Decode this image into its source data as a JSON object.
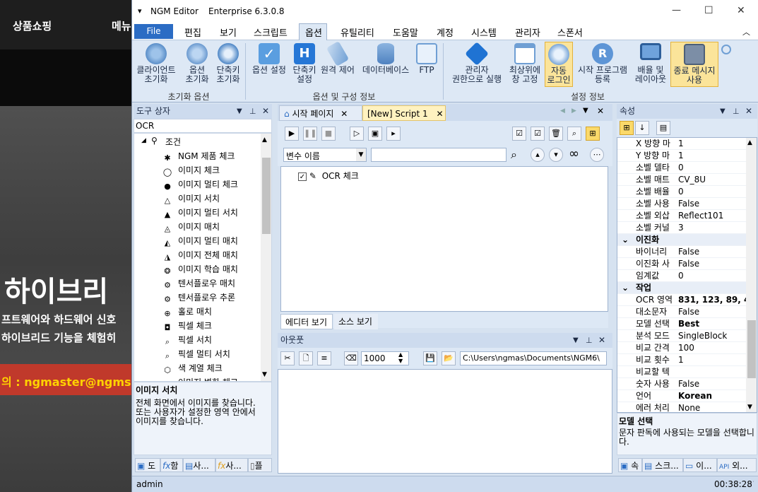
{
  "background_site": {
    "nav": [
      "상품쇼핑",
      "메뉴"
    ],
    "headline": "하이브리",
    "line1": "프트웨어와 하드웨어 신호",
    "line2": "하이브리드 기능을 체험히",
    "contact": "의 : ngmaster@ngms"
  },
  "window": {
    "app_name": "NGM Editor",
    "edition": "Enterprise 6.3.0.8",
    "controls": {
      "minimize": "—",
      "maximize": "☐",
      "close": "✕"
    }
  },
  "menu": {
    "file": "File",
    "items": [
      "편집",
      "보기",
      "스크립트",
      "옵션",
      "유틸리티",
      "도움말",
      "계정",
      "시스템",
      "관리자",
      "스폰서"
    ],
    "active": "옵션",
    "collapse": "︿"
  },
  "ribbon": {
    "groups": [
      {
        "label": "초기화 옵션",
        "buttons": [
          {
            "label": "클라이언트\n초기화",
            "icon": "gear-cluster-icon"
          },
          {
            "label": "옵션\n초기화",
            "icon": "gear-icon"
          },
          {
            "label": "단축키\n초기화",
            "icon": "gear-reset-icon"
          }
        ]
      },
      {
        "label": "옵션 및 구성 정보",
        "buttons": [
          {
            "label": "옵션 설정",
            "icon": "check-icon"
          },
          {
            "label": "단축키\n설정",
            "icon": "hotkey-icon"
          },
          {
            "label": "원격 제어",
            "icon": "remote-icon"
          },
          {
            "label": "데이터베이스",
            "icon": "database-icon"
          },
          {
            "label": "FTP",
            "icon": "cloud-drive-icon"
          }
        ]
      },
      {
        "label": "설정 정보",
        "buttons": [
          {
            "label": "관리자\n권한으로 실행",
            "icon": "admin-icon"
          },
          {
            "label": "최상위에\n창 고정",
            "icon": "window-icon"
          },
          {
            "label": "자동\n로그인",
            "icon": "key-icon"
          },
          {
            "label": "시작 프로그램\n등록",
            "icon": "registered-icon"
          },
          {
            "label": "배율 및\n레이아웃",
            "icon": "monitor-icon"
          },
          {
            "label": "종료 메시지\n사용",
            "icon": "message-icon"
          }
        ]
      }
    ]
  },
  "toolbox": {
    "title": "도구 상자",
    "search_value": "OCR",
    "root": "조건",
    "items": [
      "NGM 제품 체크",
      "이미지 체크",
      "이미지 멀티 체크",
      "이미지 서치",
      "이미지 멀티 서치",
      "이미지 매치",
      "이미지 멀티 매치",
      "이미지 전체 매치",
      "이미지 학습 매치",
      "텐서플로우 매치",
      "텐서플로우 추론",
      "홀로 매치",
      "픽셀 체크",
      "픽셀 서치",
      "픽셀 멀티 서치",
      "색 계열 체크",
      "이미지 변화 체크"
    ],
    "desc_title": "이미지 서치",
    "desc_text": "전체 화면에서 이미지를 찾습니다.\n또는 사용자가 설정한 영역 안에서\n이미지를 찾습니다.",
    "bottom_tabs": [
      "도",
      "함",
      "사...",
      "사...",
      "플"
    ]
  },
  "editor": {
    "tabs": [
      "시작 페이지",
      "[New] Script 1"
    ],
    "var_dropdown": "변수 이름",
    "search_value": "",
    "script_item": "OCR 체크",
    "view_tabs": [
      "에디터 보기",
      "소스 보기"
    ]
  },
  "output": {
    "title": "아웃풋",
    "count": "1000",
    "path": "C:\\Users\\ngmas\\Documents\\NGM6\\"
  },
  "properties": {
    "title": "속성",
    "rows": [
      {
        "name": "X 방향 마",
        "value": "1"
      },
      {
        "name": "Y 방향 마",
        "value": "1"
      },
      {
        "name": "소벨 델타",
        "value": "0"
      },
      {
        "name": "소벨 매트",
        "value": "CV_8U"
      },
      {
        "name": "소벨 배율",
        "value": "0"
      },
      {
        "name": "소벨 사용",
        "value": "False"
      },
      {
        "name": "소벨 외삽",
        "value": "Reflect101"
      },
      {
        "name": "소벨 커널",
        "value": "3"
      }
    ],
    "section_binarize": "이진화",
    "rows2": [
      {
        "name": "바이너리",
        "value": "False"
      },
      {
        "name": "이진화 사",
        "value": "False"
      },
      {
        "name": "임계값",
        "value": "0"
      }
    ],
    "section_task": "작업",
    "rows3": [
      {
        "name": "OCR 영역",
        "value": "831, 123, 89, 4"
      },
      {
        "name": "대소문자",
        "value": "False"
      },
      {
        "name": "모델 선택",
        "value": "Best"
      },
      {
        "name": "분석 모드",
        "value": "SingleBlock"
      },
      {
        "name": "비교 간격",
        "value": "100"
      },
      {
        "name": "비교 횟수",
        "value": "1"
      },
      {
        "name": "비교할 텍",
        "value": ""
      },
      {
        "name": "숫자 사용",
        "value": "False"
      },
      {
        "name": "언어",
        "value": "Korean"
      },
      {
        "name": "에러 처리",
        "value": "None"
      }
    ],
    "desc_title": "모델 선택",
    "desc_text": "문자 판독에 사용되는 모델을 선택합니다.",
    "bottom_tabs": [
      "속",
      "스크...",
      "이...",
      "외..."
    ]
  },
  "status": {
    "user": "admin",
    "time": "00:38:28"
  }
}
